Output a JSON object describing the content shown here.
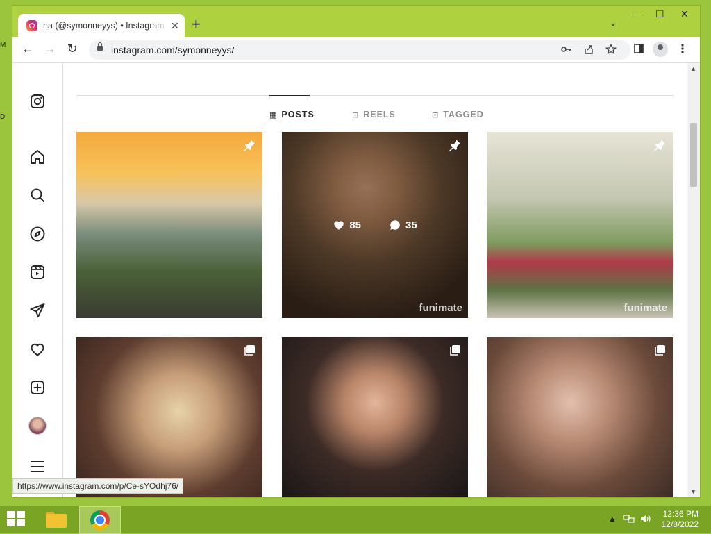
{
  "desktop": {
    "edge_letters": [
      "M",
      "D"
    ]
  },
  "browser": {
    "tab": {
      "title": "na (@symonneyys) • Instagram p",
      "close": "✕"
    },
    "new_tab": "+",
    "tab_list": "⌄",
    "window_controls": {
      "minimize": "—",
      "maximize": "☐",
      "close": "✕"
    },
    "nav": {
      "back": "←",
      "forward": "→",
      "reload": "↻"
    },
    "url": "instagram.com/symonneyys/",
    "icons": [
      "key-icon",
      "share-icon",
      "star-icon",
      "side-panel-icon",
      "profile-icon",
      "menu-icon"
    ],
    "status_url": "https://www.instagram.com/p/Ce-sYOdhj76/"
  },
  "instagram": {
    "sidenav": [
      "instagram-logo-icon",
      "home-icon",
      "search-icon",
      "explore-icon",
      "reels-icon",
      "messages-icon",
      "notifications-icon",
      "create-icon",
      "profile-avatar",
      "more-icon"
    ],
    "tabs": [
      {
        "label": "POSTS",
        "icon": "▦",
        "active": true
      },
      {
        "label": "REELS",
        "icon": "⊡",
        "active": false
      },
      {
        "label": "TAGGED",
        "icon": "⊡",
        "active": false
      }
    ],
    "posts": [
      {
        "kind": "pinned",
        "watermark": ""
      },
      {
        "kind": "pinned",
        "hover": true,
        "likes": "85",
        "comments": "35",
        "watermark": "funimate"
      },
      {
        "kind": "pinned",
        "watermark": "funimate"
      },
      {
        "kind": "carousel",
        "watermark": ""
      },
      {
        "kind": "carousel",
        "watermark": ""
      },
      {
        "kind": "carousel",
        "watermark": ""
      }
    ]
  },
  "taskbar": {
    "clock_time": "12:36 PM",
    "clock_date": "12/8/2022",
    "tray_icons": [
      "show-hidden-icon",
      "network-icon",
      "volume-icon"
    ]
  }
}
